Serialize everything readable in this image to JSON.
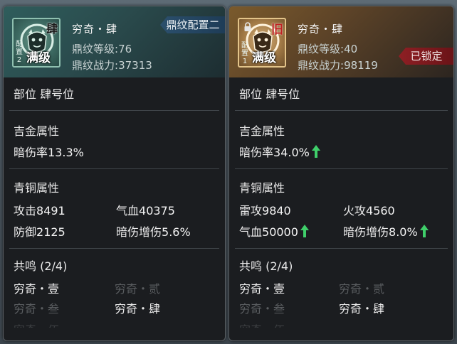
{
  "left": {
    "icon": {
      "glyph": "肆",
      "slot_label": "配置2",
      "level_label": "满级"
    },
    "name": "穷奇・肆",
    "level_label": "鼎纹等级",
    "level_value": "76",
    "power_label": "鼎纹战力",
    "power_value": "37313",
    "config_tag": "鼎纹配置二",
    "position_label": "部位",
    "position_value": "肆号位",
    "gold_title": "吉金属性",
    "gold_stats": [
      {
        "label": "暗伤率",
        "value": "13.3%"
      }
    ],
    "bronze_title": "青铜属性",
    "bronze_stats": [
      {
        "label": "攻击",
        "value": "8491"
      },
      {
        "label": "气血",
        "value": "40375"
      },
      {
        "label": "防御",
        "value": "2125"
      },
      {
        "label": "暗伤增伤",
        "value": "5.6%"
      }
    ],
    "resonance_title": "共鸣",
    "resonance_count": "(2/4)",
    "resonance_items": [
      "穷奇・壹",
      "穷奇・贰",
      "穷奇・叁",
      "穷奇・肆"
    ],
    "partial_row": "穷奇・伍"
  },
  "right": {
    "icon": {
      "glyph": "旧",
      "slot_label": "配置1",
      "level_label": "满级"
    },
    "name": "穷奇・肆",
    "level_label": "鼎纹等级",
    "level_value": "40",
    "power_label": "鼎纹战力",
    "power_value": "98119",
    "locked_tag": "已锁定",
    "position_label": "部位",
    "position_value": "肆号位",
    "gold_title": "吉金属性",
    "gold_stats": [
      {
        "label": "暗伤率",
        "value": "34.0%"
      }
    ],
    "bronze_title": "青铜属性",
    "bronze_stats": [
      {
        "label": "雷攻",
        "value": "9840"
      },
      {
        "label": "火攻",
        "value": "4560"
      },
      {
        "label": "气血",
        "value": "50000"
      },
      {
        "label": "暗伤增伤",
        "value": "8.0%"
      }
    ],
    "resonance_title": "共鸣",
    "resonance_count": "(2/4)",
    "resonance_items": [
      "穷奇・壹",
      "穷奇・贰",
      "穷奇・叁",
      "穷奇・肆"
    ],
    "partial_row": "穷奇・伍"
  },
  "colors": {
    "up_arrow": "#3fcf6a",
    "locked": "#8e1f24",
    "config_tag": "#2b4f6c"
  }
}
